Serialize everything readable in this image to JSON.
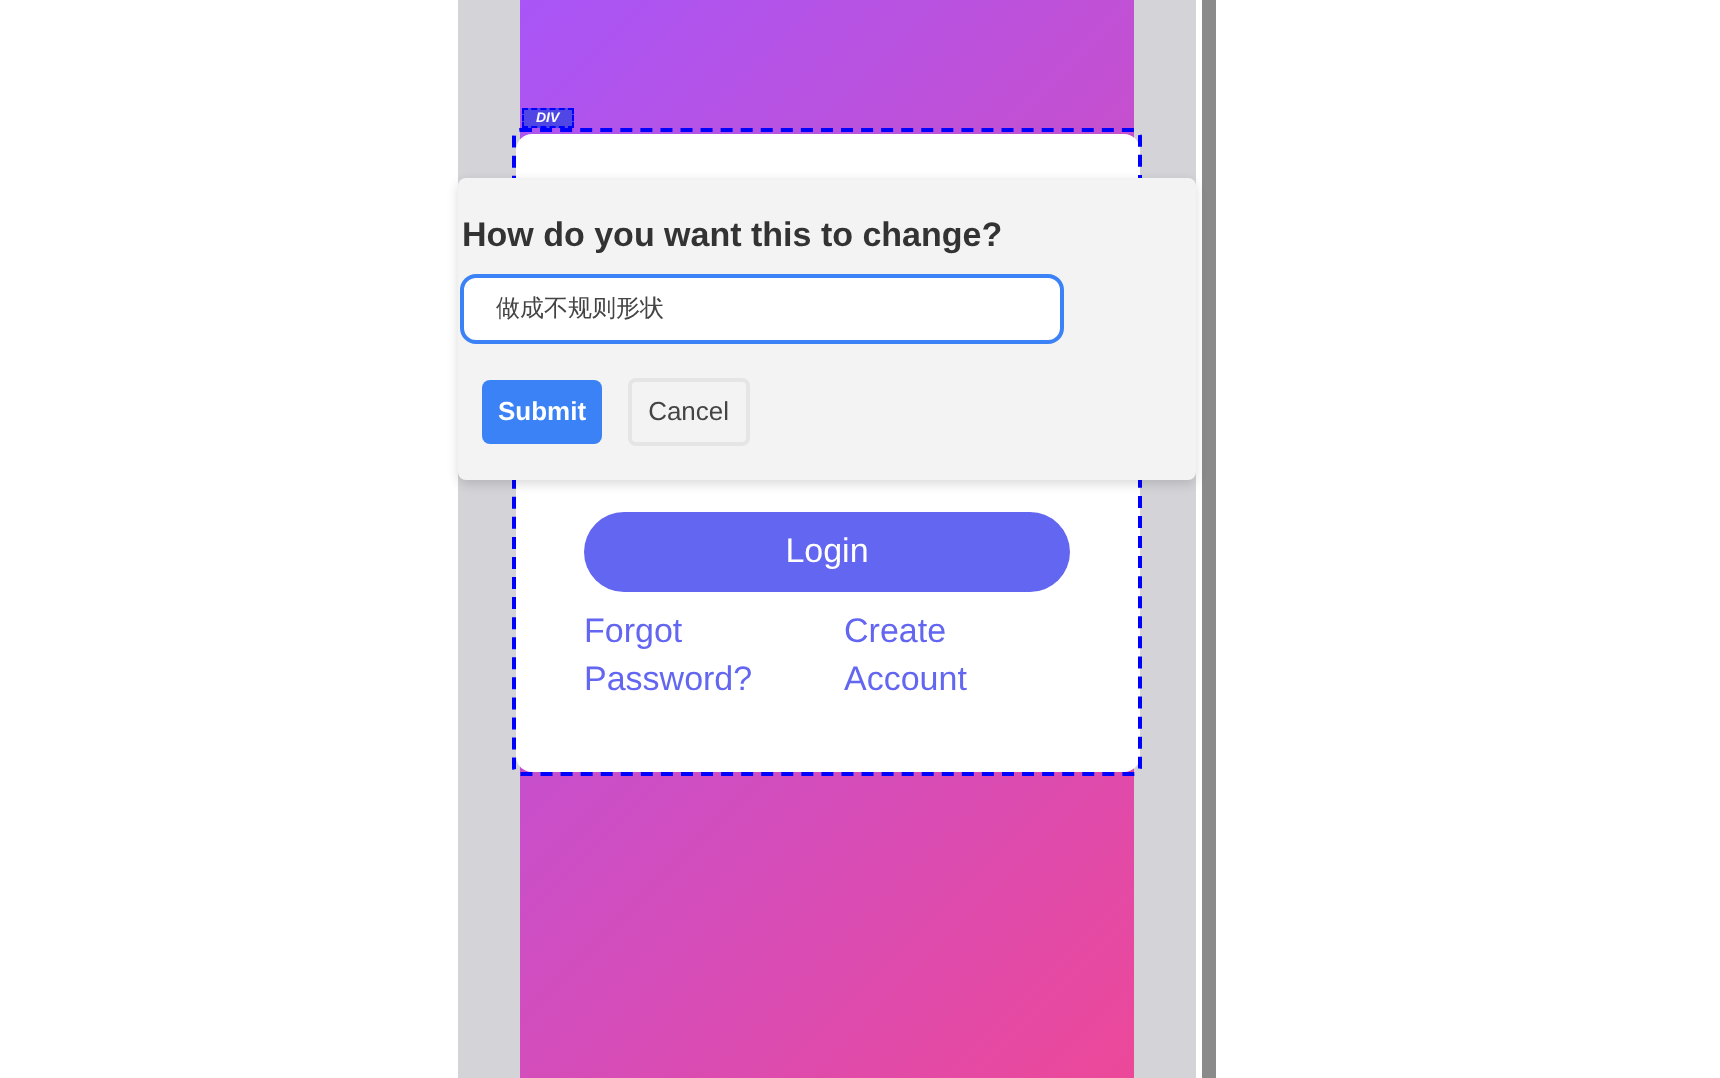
{
  "element_tag": {
    "label": "DIV"
  },
  "prompt": {
    "title": "How do you want this to change?",
    "input": {
      "value": "做成不规则形状"
    },
    "buttons": [
      {
        "label": "Submit",
        "kind": "primary"
      },
      {
        "label": "Cancel",
        "kind": "secondary"
      }
    ]
  },
  "login_card": {
    "button": "Login",
    "links": [
      "Forgot Password?",
      "Create Account"
    ]
  }
}
